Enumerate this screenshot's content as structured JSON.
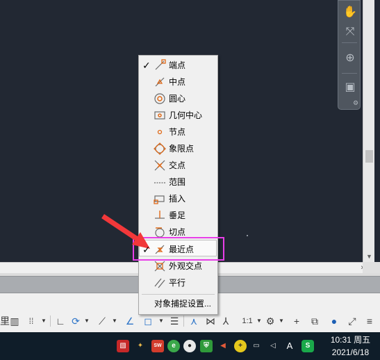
{
  "snap_menu": {
    "items": [
      {
        "label": "端点",
        "checked": true,
        "icon": "endpoint-snap-icon"
      },
      {
        "label": "中点",
        "checked": false,
        "icon": "midpoint-snap-icon"
      },
      {
        "label": "圆心",
        "checked": false,
        "icon": "center-snap-icon"
      },
      {
        "label": "几何中心",
        "checked": false,
        "icon": "geometric-center-snap-icon"
      },
      {
        "label": "节点",
        "checked": false,
        "icon": "node-snap-icon"
      },
      {
        "label": "象限点",
        "checked": false,
        "icon": "quadrant-snap-icon"
      },
      {
        "label": "交点",
        "checked": false,
        "icon": "intersection-snap-icon"
      },
      {
        "label": "范围",
        "checked": false,
        "icon": "extension-snap-icon"
      },
      {
        "label": "插入",
        "checked": false,
        "icon": "insertion-snap-icon"
      },
      {
        "label": "垂足",
        "checked": false,
        "icon": "perpendicular-snap-icon"
      },
      {
        "label": "切点",
        "checked": false,
        "icon": "tangent-snap-icon"
      },
      {
        "label": "最近点",
        "checked": true,
        "icon": "nearest-snap-icon",
        "highlighted": true
      },
      {
        "label": "外观交点",
        "checked": false,
        "icon": "apparent-intersection-snap-icon"
      },
      {
        "label": "平行",
        "checked": false,
        "icon": "parallel-snap-icon"
      }
    ],
    "settings_label": "对象捕捉设置...",
    "check_mark": "✓"
  },
  "statusbar": {
    "scale_label": "1:1"
  },
  "taskbar": {
    "time": "10:31 周五",
    "date": "2021/6/18",
    "ime_label": "A",
    "tray_icons": [
      "app-red-icon",
      "network-pin-icon",
      "sw-app-icon",
      "edge-browser-icon",
      "panda-icon",
      "shield-icon",
      "volume-icon",
      "yellow-app-icon",
      "network-icon",
      "speaker-icon",
      "ime-icon",
      "sogou-icon"
    ]
  },
  "colors": {
    "canvas": "#222833",
    "highlight_border": "#e83ee8",
    "arrow": "#f2383a",
    "snap_icon": "#e06a18",
    "taskbar": "#0f1d29"
  }
}
